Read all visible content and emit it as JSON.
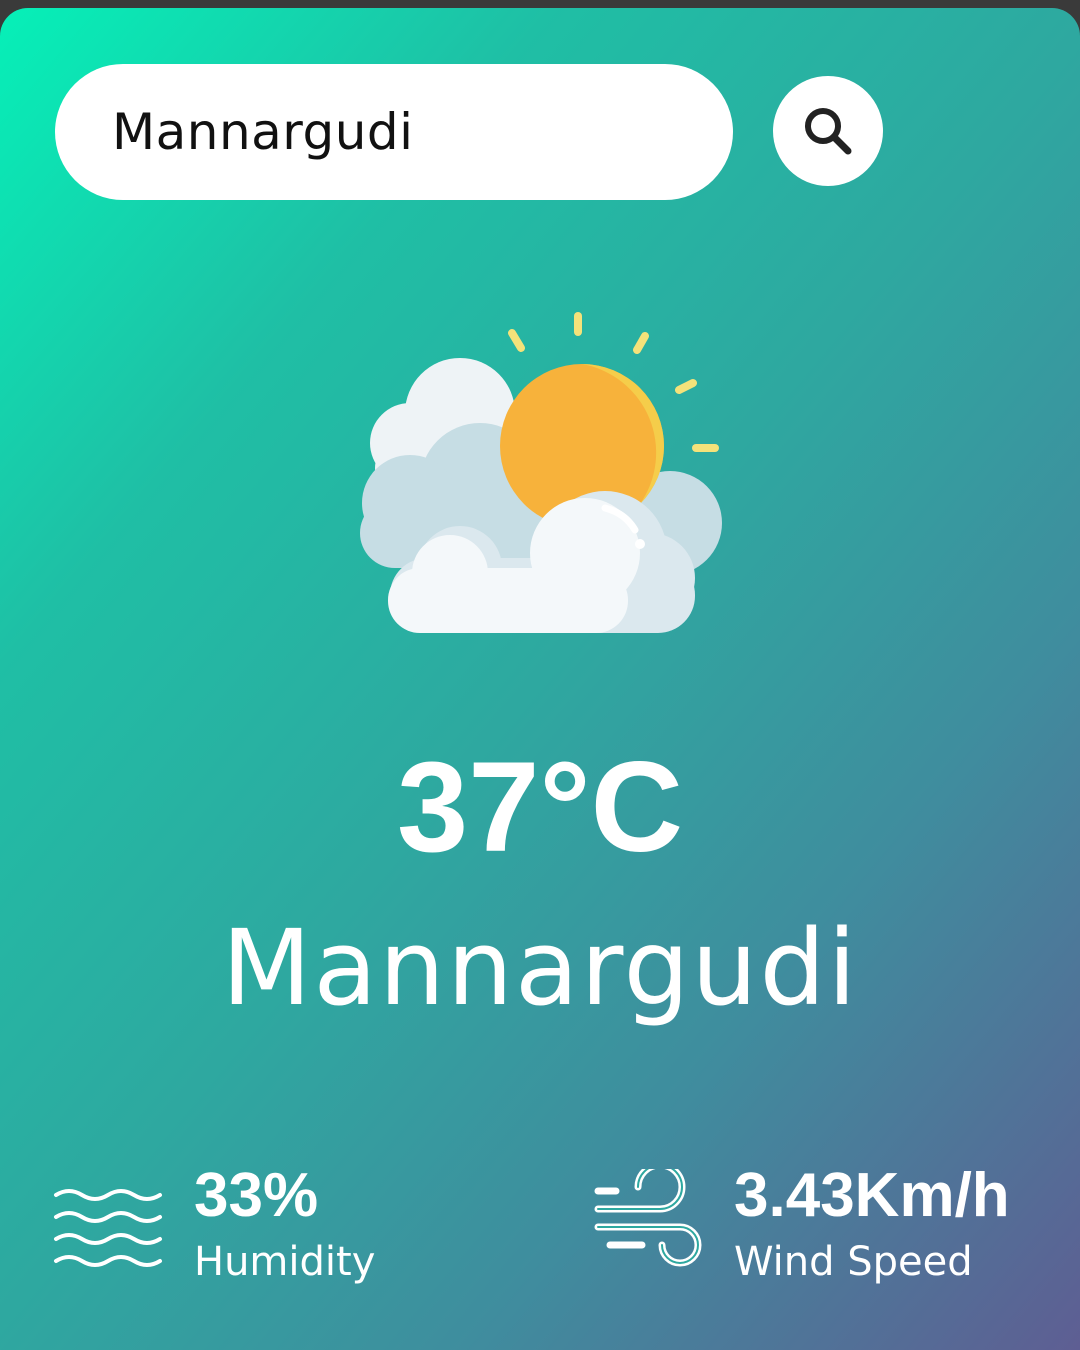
{
  "search": {
    "value": "Mannargudi",
    "button_icon": "search-icon"
  },
  "weather": {
    "icon": "partly-cloudy-icon",
    "temperature": "37°C",
    "city": "Mannargudi"
  },
  "humidity": {
    "icon": "humidity-waves-icon",
    "value": "33%",
    "label": "Humidity"
  },
  "wind": {
    "icon": "wind-icon",
    "value": "3.43Km/h",
    "label": "Wind Speed"
  },
  "colors": {
    "gradient_start": "#06f0b8",
    "gradient_end": "#5e5e93",
    "text": "#ffffff"
  }
}
